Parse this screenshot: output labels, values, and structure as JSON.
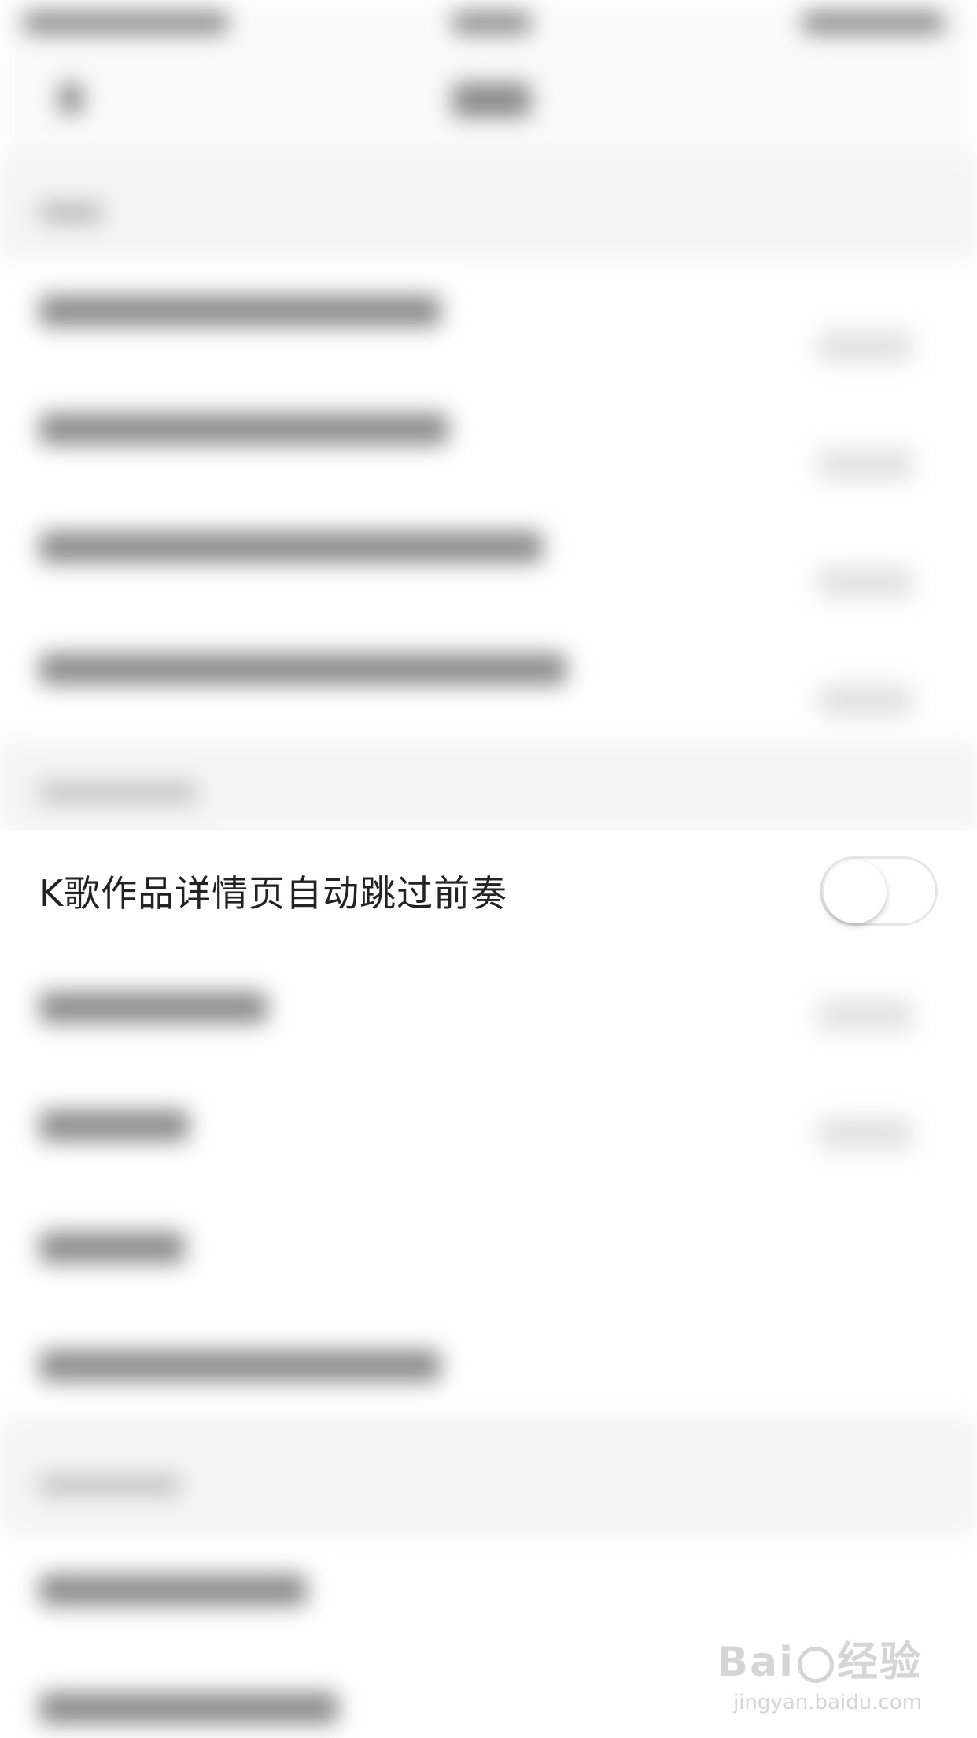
{
  "settings": {
    "highlighted_row": {
      "label": "K歌作品详情页自动跳过前奏",
      "toggle_on": false
    }
  },
  "watermark": {
    "brand_left": "Bai",
    "brand_right": "经验",
    "url": "jingyan.baidu.com"
  }
}
